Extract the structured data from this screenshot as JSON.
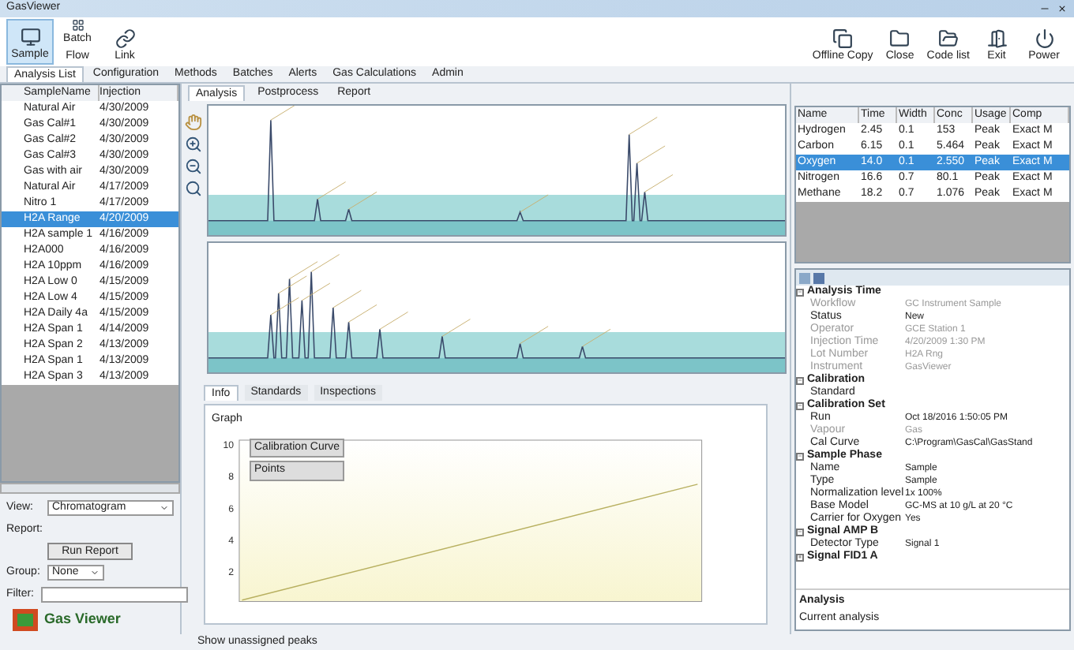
{
  "window": {
    "title": "GasViewer"
  },
  "toolbar_left": [
    {
      "label": "Sample",
      "selected": true
    },
    {
      "label": "Batch Flow",
      "selected": false
    },
    {
      "label": "Link",
      "selected": false
    }
  ],
  "toolbar_right": [
    {
      "label": "Offline Copy"
    },
    {
      "label": "Close"
    },
    {
      "label": "Code list"
    },
    {
      "label": "Exit"
    },
    {
      "label": "Power"
    }
  ],
  "menu_tabs": [
    {
      "label": "Analysis List",
      "selected": true
    },
    {
      "label": "Configuration",
      "selected": false
    },
    {
      "label": "Methods",
      "selected": false
    },
    {
      "label": "Batches",
      "selected": false
    },
    {
      "label": "Alerts",
      "selected": false
    },
    {
      "label": "Gas Calculations",
      "selected": false
    },
    {
      "label": "Admin",
      "selected": false
    }
  ],
  "samples": {
    "columns": [
      "SampleName",
      "Injection"
    ],
    "rows": [
      {
        "cells": [
          "Natural Air",
          "4/30/2009"
        ],
        "selected": false
      },
      {
        "cells": [
          "Gas Cal#1",
          "4/30/2009"
        ],
        "selected": false
      },
      {
        "cells": [
          "Gas Cal#2",
          "4/30/2009"
        ],
        "selected": false
      },
      {
        "cells": [
          "Gas Cal#3",
          "4/30/2009"
        ],
        "selected": false
      },
      {
        "cells": [
          "Gas with air",
          "4/30/2009"
        ],
        "selected": false
      },
      {
        "cells": [
          "Natural Air",
          "4/17/2009"
        ],
        "selected": false
      },
      {
        "cells": [
          "Nitro 1",
          "4/17/2009"
        ],
        "selected": false
      },
      {
        "cells": [
          "H2A Range",
          "4/20/2009"
        ],
        "selected": true
      },
      {
        "cells": [
          "H2A sample 1",
          "4/16/2009"
        ],
        "selected": false
      },
      {
        "cells": [
          "H2A000",
          "4/16/2009"
        ],
        "selected": false
      },
      {
        "cells": [
          "H2A 10ppm",
          "4/16/2009"
        ],
        "selected": false
      },
      {
        "cells": [
          "H2A Low 0",
          "4/15/2009"
        ],
        "selected": false
      },
      {
        "cells": [
          "H2A Low 4",
          "4/15/2009"
        ],
        "selected": false
      },
      {
        "cells": [
          "H2A Daily 4a",
          "4/15/2009"
        ],
        "selected": false
      },
      {
        "cells": [
          "H2A Span 1",
          "4/14/2009"
        ],
        "selected": false
      },
      {
        "cells": [
          "H2A Span 2",
          "4/13/2009"
        ],
        "selected": false
      },
      {
        "cells": [
          "H2A Span 1",
          "4/13/2009"
        ],
        "selected": false
      },
      {
        "cells": [
          "H2A Span 3",
          "4/13/2009"
        ],
        "selected": false
      }
    ]
  },
  "left_controls": {
    "view_label": "View:",
    "view_value": "Chromatogram",
    "report_label": "Report:",
    "report_button": "Run Report",
    "group_label": "Group:",
    "group_value": "None",
    "filter_label": "Filter:"
  },
  "logo": {
    "text": "Gas Viewer"
  },
  "view_tabs": [
    {
      "label": "Analysis",
      "selected": true
    },
    {
      "label": "Postprocess",
      "selected": false
    },
    {
      "label": "Report",
      "selected": false
    }
  ],
  "peaks": {
    "columns": [
      "Name",
      "Time",
      "Width",
      "Conc",
      "Usage",
      "Comp"
    ],
    "rows": [
      {
        "cells": [
          "Hydrogen",
          "2.45",
          "0.1",
          "153",
          "Peak",
          "Exact M"
        ],
        "selected": false
      },
      {
        "cells": [
          "Carbon",
          "6.15",
          "0.1",
          "5.464",
          "Peak",
          "Exact M"
        ],
        "selected": false
      },
      {
        "cells": [
          "Oxygen",
          "14.0",
          "0.1",
          "2.550",
          "Peak",
          "Exact M"
        ],
        "selected": true
      },
      {
        "cells": [
          "Nitrogen",
          "16.6",
          "0.7",
          "80.1",
          "Peak",
          "Exact M"
        ],
        "selected": false
      },
      {
        "cells": [
          "Methane",
          "18.2",
          "0.7",
          "1.076",
          "Peak",
          "Exact M"
        ],
        "selected": false
      }
    ]
  },
  "properties": {
    "sections": [
      {
        "title": "Analysis Time",
        "expanded": true,
        "items": [
          {
            "label": "Workflow",
            "value": "GC Instrument Sample",
            "disabled": true
          },
          {
            "label": "Status",
            "value": "New",
            "disabled": false
          },
          {
            "label": "Operator",
            "value": "GCE Station 1",
            "disabled": true
          },
          {
            "label": "Injection Time",
            "value": "4/20/2009 1:30 PM",
            "disabled": true
          },
          {
            "label": "Lot Number",
            "value": "H2A Rng",
            "disabled": true
          },
          {
            "label": "Instrument",
            "value": "GasViewer",
            "disabled": true
          }
        ]
      },
      {
        "title": "Calibration",
        "expanded": true,
        "items": [
          {
            "label": "Standard",
            "value": "",
            "disabled": false
          }
        ]
      },
      {
        "title": "Calibration Set",
        "expanded": true,
        "items": [
          {
            "label": "Run",
            "value": "Oct 18/2016 1:50:05 PM",
            "disabled": false
          },
          {
            "label": "Vapour",
            "value": "Gas",
            "disabled": true
          },
          {
            "label": "Cal Curve",
            "value": "C:\\Program\\GasCal\\GasStand",
            "disabled": false
          }
        ]
      },
      {
        "title": "Sample Phase",
        "expanded": true,
        "items": [
          {
            "label": "Name",
            "value": "Sample",
            "disabled": false
          },
          {
            "label": "Type",
            "value": "Sample",
            "disabled": false
          },
          {
            "label": "Normalization level",
            "value": "1x 100%",
            "disabled": false
          },
          {
            "label": "Base Model",
            "value": "GC-MS at 10 g/L at 20 °C",
            "disabled": false
          },
          {
            "label": "Carrier for Oxygen",
            "value": "Yes",
            "disabled": false
          }
        ]
      },
      {
        "title": "Signal AMP B",
        "expanded": true,
        "items": [
          {
            "label": "Detector Type",
            "value": "Signal 1",
            "disabled": false
          }
        ]
      },
      {
        "title": "Signal FID1 A",
        "expanded": false
      }
    ]
  },
  "property_help": {
    "title": "Analysis",
    "text": "Current analysis"
  },
  "lower_tabs": [
    {
      "label": "Info",
      "selected": true
    },
    {
      "label": "Standards",
      "selected": false
    },
    {
      "label": "Inspections",
      "selected": false
    }
  ],
  "calibration": {
    "group_label": "Graph",
    "legend": [
      "Calibration Curve",
      "Points"
    ],
    "y_axis_labels": [
      "10",
      "8",
      "6",
      "4",
      "2"
    ]
  },
  "status_bar": {
    "label": "Show unassigned peaks"
  }
}
